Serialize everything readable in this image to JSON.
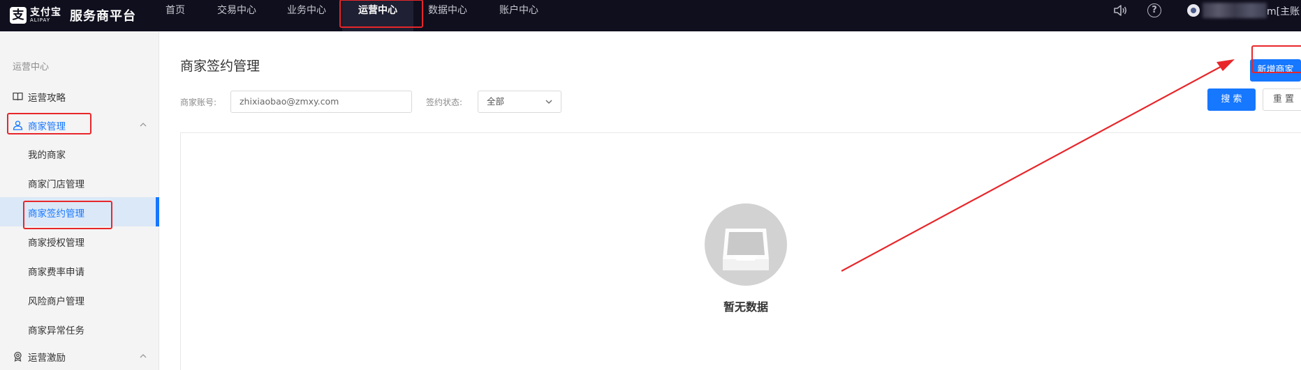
{
  "app": {
    "logo_cn": "支付宝",
    "logo_en": "ALIPAY",
    "title": "服务商平台"
  },
  "nav": {
    "items": [
      "首页",
      "交易中心",
      "业务中心",
      "运营中心",
      "数据中心",
      "账户中心"
    ],
    "active": "运营中心"
  },
  "account": {
    "name_suffix": "m[主账"
  },
  "sidebar": {
    "group_title": "运营中心",
    "items": [
      {
        "label": "运营攻略",
        "icon": "book-icon"
      },
      {
        "label": "商家管理",
        "icon": "user-icon"
      },
      {
        "label": "运营激励",
        "icon": "medal-icon"
      }
    ],
    "merchant_subitems": [
      "我的商家",
      "商家门店管理",
      "商家签约管理",
      "商家授权管理",
      "商家费率申请",
      "风险商户管理",
      "商家异常任务"
    ],
    "active_subitem": "商家签约管理"
  },
  "main": {
    "page_title": "商家签约管理",
    "add_button": "新增商家",
    "filters": {
      "account_label": "商家账号:",
      "account_placeholder": "zhixiaobao@zmxy.com",
      "status_label": "签约状态:",
      "status_value": "全部"
    },
    "search_button": "搜 索",
    "reset_button": "重 置",
    "empty_text": "暂无数据"
  },
  "colors": {
    "accent": "#1677ff",
    "topbar": "#0f0f1e",
    "annotation": "#e8262a"
  }
}
